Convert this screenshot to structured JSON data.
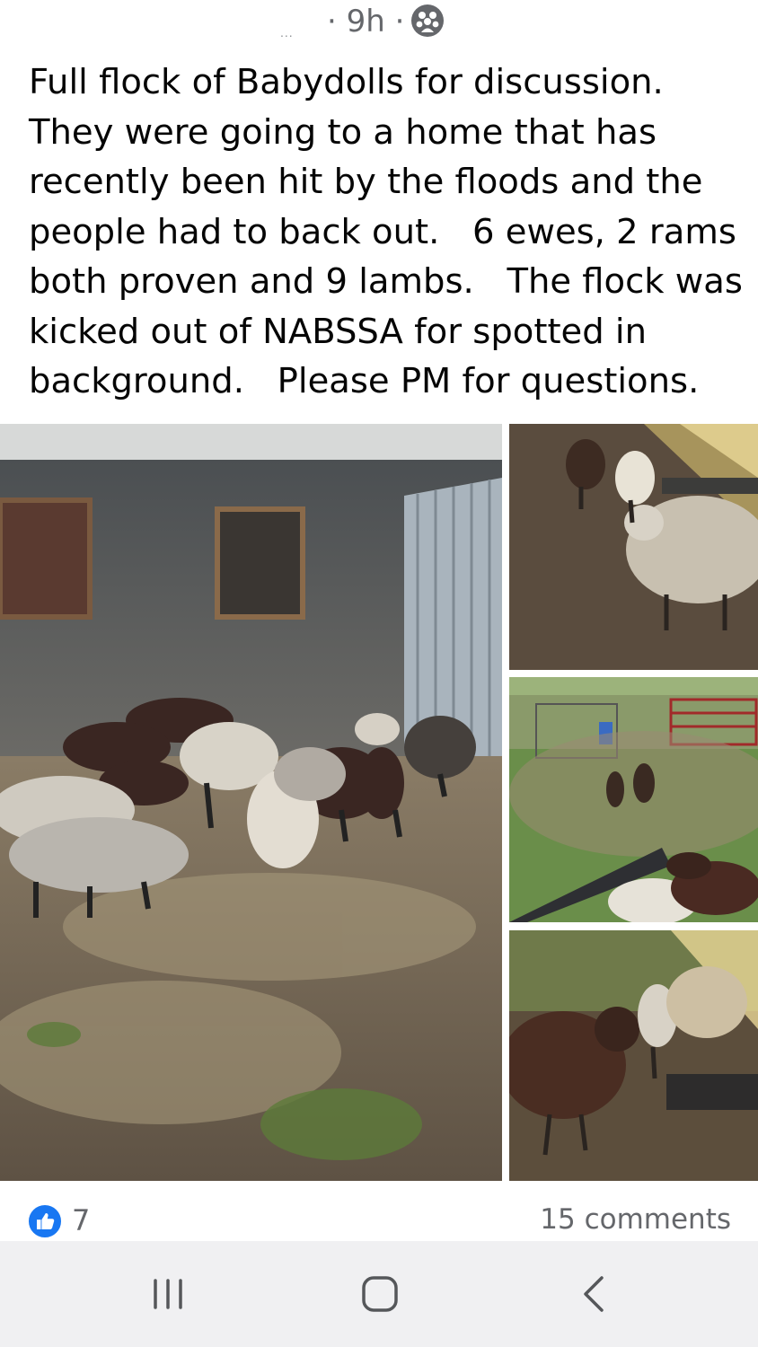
{
  "header": {
    "author_placeholder": "...",
    "time": "· 9h ·",
    "audience_icon": "friends-icon"
  },
  "post": {
    "text": "Full flock of Babydolls for discussion.\nThey were going to a home that has\nrecently been hit by the floods and the\npeople had to back out.   6 ewes, 2 rams\nboth proven and 9 lambs.   The flock was\nkicked out of NABSSA for spotted in\nbackground.   Please PM for questions."
  },
  "photos": [
    {
      "name": "sheep-in-shed-photo"
    },
    {
      "name": "sheep-at-feeder-sunlit-photo"
    },
    {
      "name": "lambs-in-pasture-photo"
    },
    {
      "name": "lambs-at-trough-photo"
    }
  ],
  "reactions": {
    "like_icon": "thumbs-up-icon",
    "like_count": "7",
    "comments": "15 comments",
    "like_color": "#1877f2"
  },
  "navigation": {
    "recents": "recent-apps-icon",
    "home": "home-icon",
    "back": "back-icon"
  }
}
